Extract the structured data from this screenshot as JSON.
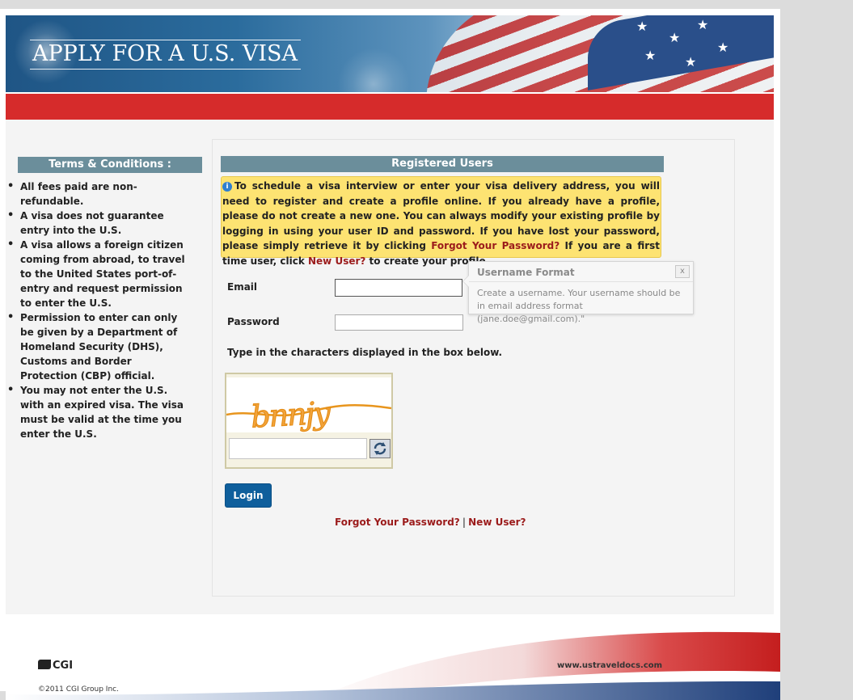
{
  "header": {
    "title": "APPLY FOR A U.S. VISA"
  },
  "terms": {
    "heading": "Terms & Conditions :",
    "items": [
      "All fees paid are non-refundable.",
      "A visa does not guarantee entry into the U.S.",
      "A visa allows a foreign citizen coming from abroad, to travel to the United States port-of-entry and request permission to enter the U.S.",
      "Permission to enter can only be given by a Department of Homeland Security (DHS), Customs and Border Protection (CBP) official.",
      "You may not enter the U.S. with an expired visa. The visa must be valid at the time you enter the U.S."
    ]
  },
  "registered": {
    "heading": "Registered Users",
    "notice": {
      "part1": "To schedule a visa interview or enter your visa delivery address, you will need to register and create a profile online. If you already have a profile, please do not create a new one. You can always modify your existing profile by logging in using your user ID and password. If you have lost your password, please simply retrieve it by clicking ",
      "forgot_link": "Forgot Your Password?",
      "part2": " If you are a first time user, click ",
      "new_user_link": "New User?",
      "part3": " to create your profile."
    },
    "email_label": "Email",
    "email_value": "",
    "password_label": "Password",
    "password_value": "",
    "captcha_prompt": "Type in the characters displayed in the box below.",
    "captcha_text": "bnnjy",
    "captcha_value": "",
    "login_label": "Login",
    "forgot_label": "Forgot Your Password?",
    "separator": "|",
    "new_user_label": "New User?"
  },
  "tooltip": {
    "title": "Username Format",
    "close": "x",
    "body": "Create a username. Your username should be in email address format (jane.doe@gmail.com).\""
  },
  "footer": {
    "brand": "CGI",
    "copyright": "©2011 CGI Group Inc.",
    "url": "www.ustraveldocs.com"
  },
  "colors": {
    "accent_red": "#d62b2b",
    "heading_bar": "#6b8e9b",
    "notice_bg": "#fde372",
    "link_red": "#9b1b1b",
    "button_blue": "#0f5f9c"
  },
  "icons": {
    "info": "info-icon",
    "refresh": "refresh-icon",
    "close": "close-icon"
  }
}
